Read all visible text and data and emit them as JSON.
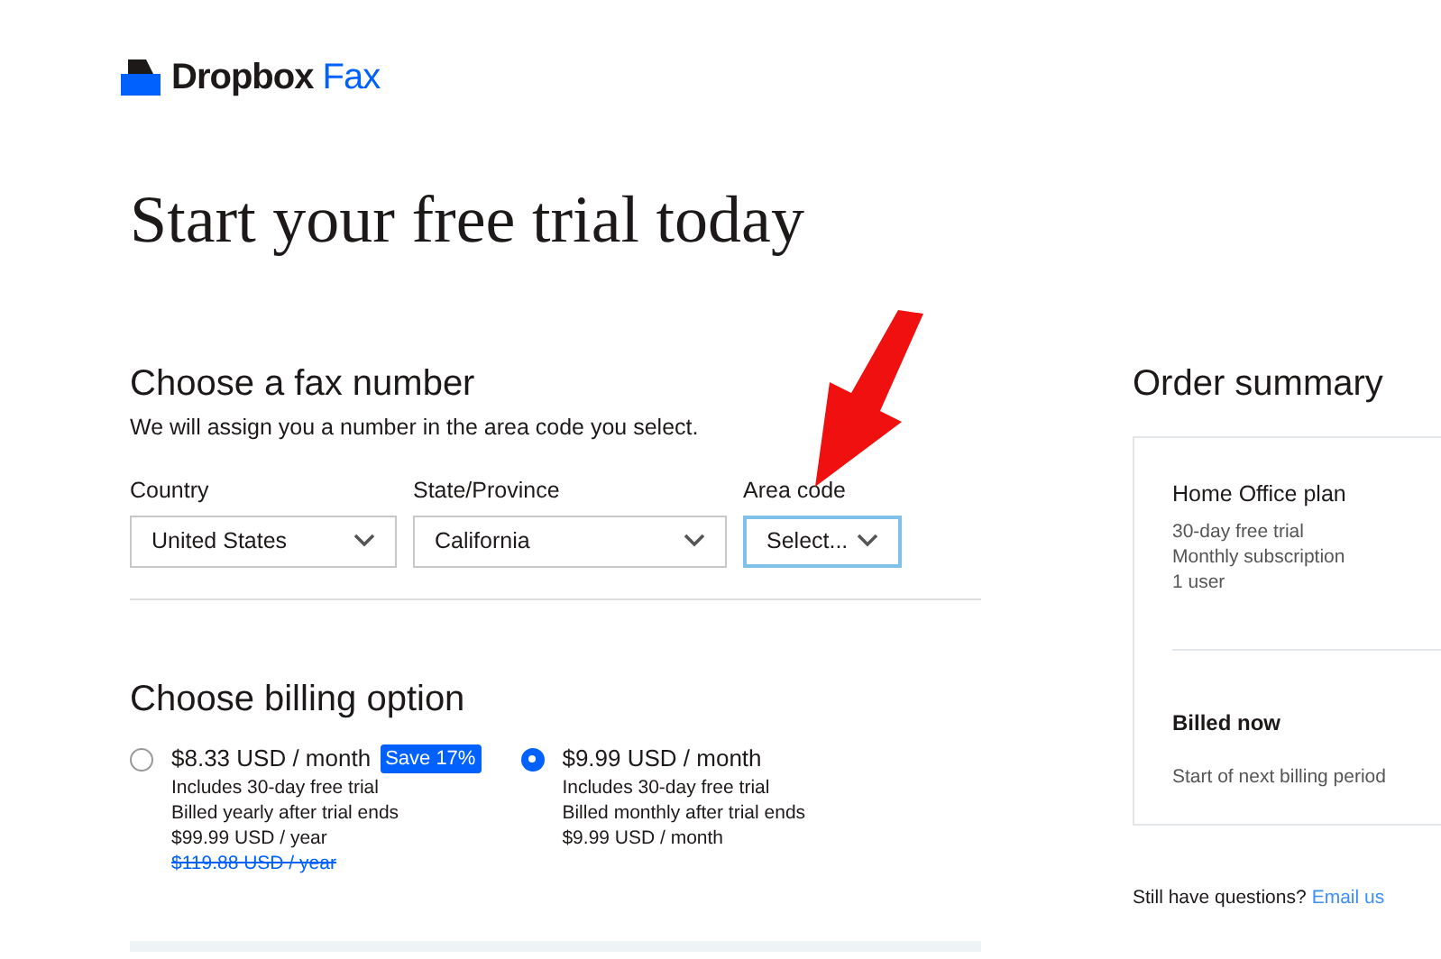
{
  "logo": {
    "brand": "Dropbox",
    "product": "Fax"
  },
  "title": "Start your free trial today",
  "fax_number": {
    "heading": "Choose a fax number",
    "subtitle": "We will assign you a number in the area code you select.",
    "fields": [
      {
        "label": "Country",
        "value": "United States",
        "focused": false
      },
      {
        "label": "State/Province",
        "value": "California",
        "focused": false
      },
      {
        "label": "Area code",
        "value": "Select...",
        "focused": true
      }
    ]
  },
  "billing": {
    "heading": "Choose billing option",
    "options": [
      {
        "price": "$8.33 USD / month",
        "badge": "Save 17%",
        "selected": false,
        "lines": [
          "Includes 30-day free trial",
          "Billed yearly after trial ends",
          "$99.99 USD / year"
        ],
        "old_price": "$119.88 USD / year"
      },
      {
        "price": "$9.99 USD / month",
        "selected": true,
        "lines": [
          "Includes 30-day free trial",
          "Billed monthly after trial ends",
          "$9.99 USD / month"
        ]
      }
    ]
  },
  "order_summary": {
    "heading": "Order summary",
    "plan": "Home Office plan",
    "plan_lines": [
      "30-day free trial",
      "Monthly subscription",
      "1 user"
    ],
    "billed_now": "Billed now",
    "billed_note": "Start of next billing period"
  },
  "help": {
    "text": "Still have questions?",
    "link": "Email us"
  }
}
